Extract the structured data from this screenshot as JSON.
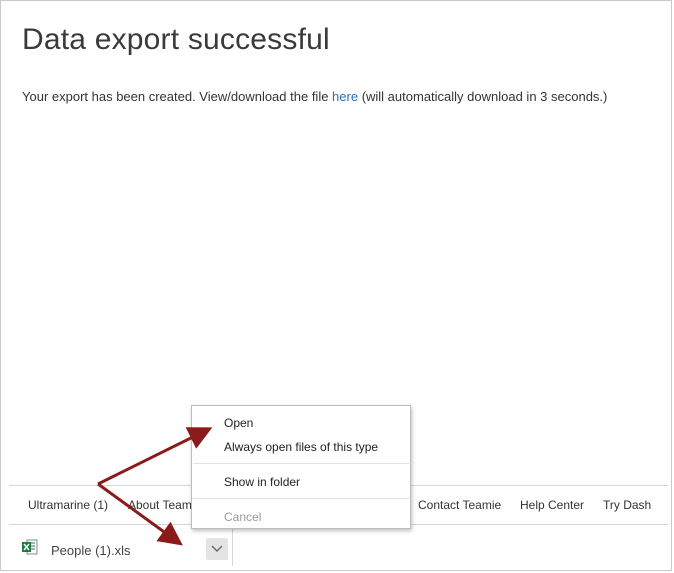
{
  "page": {
    "title": "Data export successful",
    "message_before": "Your export has been created. View/download the file ",
    "message_link": "here",
    "message_after": " (will automatically download in 3 seconds.)"
  },
  "footer": {
    "links": [
      "Ultramarine (1)",
      "About Teamie",
      "Contact Teamie",
      "Help Center",
      "Try Dash"
    ]
  },
  "download": {
    "file_name": "People (1).xls",
    "icon": "excel-file-icon"
  },
  "context_menu": {
    "items": [
      "Open",
      "Always open files of this type",
      "Show in folder",
      "Cancel"
    ]
  },
  "colors": {
    "link": "#2a6ebb",
    "annotation_arrow": "#8b1a1a",
    "excel_green": "#1d7a3e"
  }
}
